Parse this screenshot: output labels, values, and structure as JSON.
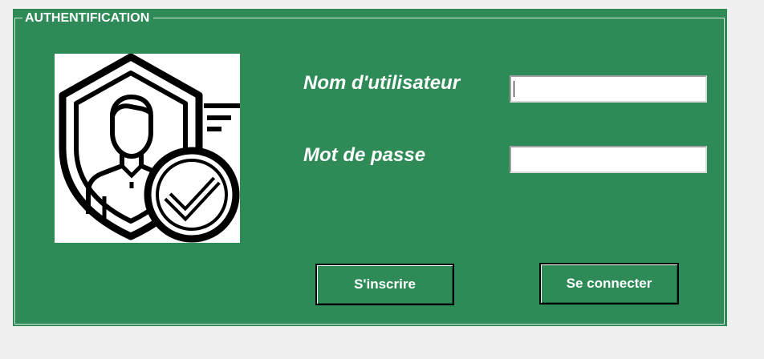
{
  "window": {
    "group_title": "AUTHENTIFICATION"
  },
  "logo": {
    "icon": "shield-user-check-icon"
  },
  "form": {
    "username_label": "Nom d'utilisateur",
    "username_value": "",
    "password_label": "Mot de passe",
    "password_value": ""
  },
  "buttons": {
    "register_label": "S'inscrire",
    "connect_label": "Se connecter"
  },
  "colors": {
    "panel": "#2e8b57",
    "background": "#f0f0f0",
    "text": "#ffffff"
  }
}
